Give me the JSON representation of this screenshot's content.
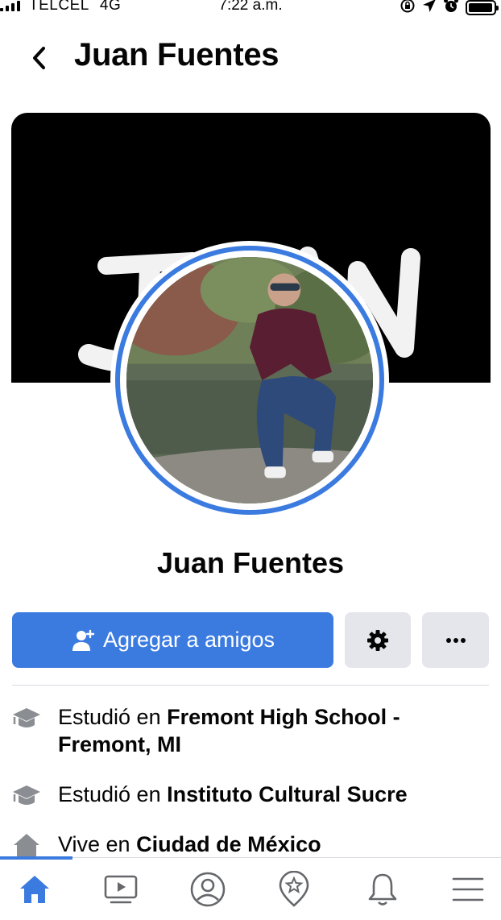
{
  "status_bar": {
    "carrier": "TELCEL",
    "network": "4G",
    "time": "7:22 a.m.",
    "icons": [
      "orientation-lock-icon",
      "location-arrow-icon",
      "alarm-icon",
      "battery-icon"
    ],
    "battery_level": 0.95
  },
  "header": {
    "back_icon": "chevron-left-icon",
    "title": "Juan Fuentes"
  },
  "profile": {
    "cover_text": "JUAN",
    "name": "Juan Fuentes",
    "avatar_ring_color": "#3b7be0"
  },
  "actions": {
    "add_friend_label": "Agregar a amigos",
    "add_friend_icon": "add-person-icon",
    "settings_icon": "gear-icon",
    "more_icon": "more-dots-icon",
    "primary_color": "#3b7be0"
  },
  "intro": {
    "items": [
      {
        "icon": "education-cap-icon",
        "prefix": "Estudió en",
        "value": "Fremont High School - Fremont, MI"
      },
      {
        "icon": "education-cap-icon",
        "prefix": "Estudió en",
        "value": "Instituto Cultural Sucre"
      },
      {
        "icon": "home-icon",
        "prefix": "Vive en",
        "value": "Ciudad de México"
      }
    ]
  },
  "bottom_nav": {
    "items": [
      "home-icon",
      "watch-icon",
      "profile-icon",
      "pages-icon",
      "notifications-icon",
      "menu-icon"
    ],
    "active_index": 0
  }
}
